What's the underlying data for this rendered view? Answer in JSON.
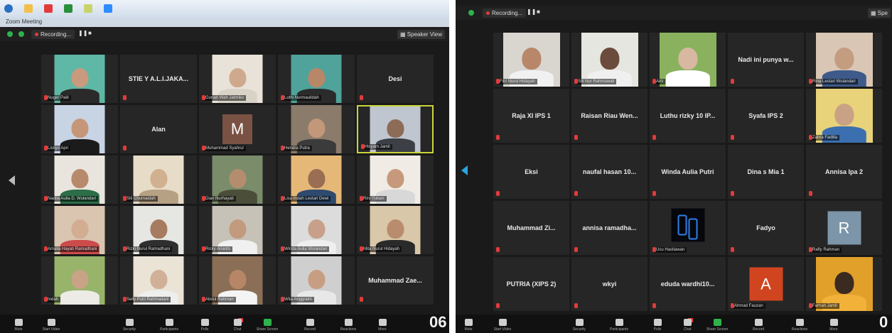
{
  "left": {
    "window_title": "Zoom Meeting",
    "recording_label": "Recording...",
    "view_label": "Speaker View",
    "clock": "06",
    "tiles": [
      {
        "type": "photo",
        "name": "",
        "label": "Nuger Paiti",
        "bg": "#5fb7a6",
        "skin": "#c99a7d",
        "cloth": "#2a2a2a"
      },
      {
        "type": "text",
        "name": "STIE Y A.L.I.JAKA...",
        "label": ""
      },
      {
        "type": "photo",
        "name": "",
        "label": "Gunari Wah Jatmiko",
        "bg": "#e8e2d8",
        "skin": "#cfa98e",
        "cloth": "#d9d2c6"
      },
      {
        "type": "photo",
        "name": "",
        "label": "Luthi Nurmaulidah",
        "bg": "#4fa39a",
        "skin": "#b88768",
        "cloth": "#2b2b2b"
      },
      {
        "type": "text",
        "name": "Desi",
        "label": ""
      },
      {
        "type": "photo",
        "name": "",
        "label": "Listiyo Apri",
        "bg": "#c8d3e4",
        "skin": "#c69678",
        "cloth": "#1b1b1b"
      },
      {
        "type": "text",
        "name": "Alan",
        "label": ""
      },
      {
        "type": "letter",
        "letter": "M",
        "letter_bg": "#7a5243",
        "label": "Muhammad Syahrul"
      },
      {
        "type": "photo",
        "name": "",
        "label": "Hendra Putra",
        "bg": "#8b7b6b",
        "skin": "#c3977a",
        "cloth": "#3b3b3b"
      },
      {
        "type": "photo",
        "name": "",
        "label": "Hisyam Jamil",
        "bg": "#bfc6cf",
        "skin": "#8c6b57",
        "cloth": "#3c3f45",
        "active": true
      },
      {
        "type": "photo",
        "name": "",
        "label": "Nadila Aulia D. Wulandari",
        "bg": "#e9e5de",
        "skin": "#b88a6c",
        "cloth": "#2b6e48"
      },
      {
        "type": "photo",
        "name": "",
        "label": "Siti Chumaidah",
        "bg": "#e6dcc8",
        "skin": "#d0b08e",
        "cloth": "#b7a184"
      },
      {
        "type": "photo",
        "name": "",
        "label": "Dian Nurhayati",
        "bg": "#7a8c6a",
        "skin": "#b48d6f",
        "cloth": "#4b4f3a"
      },
      {
        "type": "photo",
        "name": "",
        "label": "Lisa Indah Lestari Dewi",
        "bg": "#e6b878",
        "skin": "#9a6e53",
        "cloth": "#2e4a6e"
      },
      {
        "type": "photo",
        "name": "",
        "label": "Rini Yuliani",
        "bg": "#f0ebe4",
        "skin": "#c7997c",
        "cloth": "#d8d8d8"
      },
      {
        "type": "photo",
        "name": "",
        "label": "Amalia Hayati Ramadhani",
        "bg": "#d9c5b0",
        "skin": "#d2ad92",
        "cloth": "#cc4b4b"
      },
      {
        "type": "photo",
        "name": "",
        "label": "Rizki Nurul Ramadhani",
        "bg": "#e6e6e2",
        "skin": "#a77b60",
        "cloth": "#2f2f2f"
      },
      {
        "type": "photo",
        "name": "",
        "label": "Ricky Arianto",
        "bg": "#c7c2b8",
        "skin": "#c29a7e",
        "cloth": "#f0f0f0"
      },
      {
        "type": "photo",
        "name": "",
        "label": "Winda Aulia Wulandari",
        "bg": "#dcdcdc",
        "skin": "#c8a08a",
        "cloth": "#efefef"
      },
      {
        "type": "photo",
        "name": "",
        "label": "Mita Nurul Hidayah",
        "bg": "#d8c7a8",
        "skin": "#b88c6c",
        "cloth": "#2a2a2a"
      },
      {
        "type": "photo",
        "name": "",
        "label": "Indah",
        "bg": "#97b46a",
        "skin": "#c9a386",
        "cloth": "#ecebe6"
      },
      {
        "type": "photo",
        "name": "",
        "label": "Selly Putri Rahmadani",
        "bg": "#eae3d6",
        "skin": "#d1b098",
        "cloth": "#eeeeee"
      },
      {
        "type": "photo",
        "name": "",
        "label": "Abdul Rahman",
        "bg": "#8a6f56",
        "skin": "#b68667",
        "cloth": "#f4f4f4"
      },
      {
        "type": "photo",
        "name": "",
        "label": "Wita Anggraini",
        "bg": "#d0cfcf",
        "skin": "#c89e82",
        "cloth": "#e8e8e8"
      },
      {
        "type": "text",
        "name": "Muhammad Zae...",
        "label": ""
      }
    ],
    "toolbar": [
      {
        "icon": "mic-icon",
        "label": "Mute"
      },
      {
        "icon": "video-icon",
        "label": "Start Video"
      },
      {
        "icon": "security-icon",
        "label": "Security"
      },
      {
        "icon": "participants-icon",
        "label": "Participants"
      },
      {
        "icon": "polls-icon",
        "label": "Polls"
      },
      {
        "icon": "chat-icon",
        "label": "Chat"
      },
      {
        "icon": "share-screen-icon",
        "label": "Share Screen"
      },
      {
        "icon": "record-icon",
        "label": "Record"
      },
      {
        "icon": "reactions-icon",
        "label": "Reactions"
      },
      {
        "icon": "more-icon",
        "label": "More"
      }
    ]
  },
  "right": {
    "recording_label": "Recording...",
    "view_label": "Spe",
    "clock": "0",
    "tiles": [
      {
        "type": "photo",
        "name": "",
        "label": "Fitri Nurul Hidayah",
        "bg": "#d8d6cf",
        "skin": "#b8876a",
        "cloth": "#f1f1f1"
      },
      {
        "type": "photo",
        "name": "",
        "label": "Siti Nur Rahmawati",
        "bg": "#e6e6e0",
        "skin": "#6b4b3b",
        "cloth": "#f0f0f0"
      },
      {
        "type": "photo",
        "name": "",
        "label": "Aini",
        "bg": "#8ab25e",
        "skin": "#d8b8a0",
        "cloth": "#ffffff"
      },
      {
        "type": "text",
        "name": "Nadi ini punya w...",
        "label": ""
      },
      {
        "type": "photo",
        "name": "",
        "label": "Rina Lestari Wulandari",
        "bg": "#d9c6b5",
        "skin": "#c49c80",
        "cloth": "#3d5a8a"
      },
      {
        "type": "text",
        "name": "Raja XI IPS 1",
        "label": ""
      },
      {
        "type": "text",
        "name": "Raisan Riau Wen...",
        "label": ""
      },
      {
        "type": "text",
        "name": "Luthu rizky  10 IP...",
        "label": ""
      },
      {
        "type": "text",
        "name": "Syafa IPS 2",
        "label": ""
      },
      {
        "type": "photo",
        "name": "",
        "label": "Zahra Fadilla",
        "bg": "#e8d27a",
        "skin": "#c9a285",
        "cloth": "#3b6fb0"
      },
      {
        "type": "text",
        "name": "Eksi",
        "label": ""
      },
      {
        "type": "text",
        "name": "naufal hasan 10...",
        "label": ""
      },
      {
        "type": "text",
        "name": "Winda Aulia Putri",
        "label": ""
      },
      {
        "type": "text",
        "name": "Dina  s Mia 1",
        "label": ""
      },
      {
        "type": "text",
        "name": "Annisa Ipa 2",
        "label": ""
      },
      {
        "type": "text",
        "name": "Muhammad Zi...",
        "label": ""
      },
      {
        "type": "text",
        "name": "annisa  ramadha...",
        "label": ""
      },
      {
        "type": "logo",
        "label": "Ucu Hastiawan"
      },
      {
        "type": "text",
        "name": "Fadyo",
        "label": ""
      },
      {
        "type": "letter",
        "letter": "R",
        "letter_bg": "#7c95a8",
        "label": "Rafly Rahman"
      },
      {
        "type": "text",
        "name": "PUTRIA (XIPS 2)",
        "label": ""
      },
      {
        "type": "text",
        "name": "wkyi",
        "label": ""
      },
      {
        "type": "text",
        "name": "eduda  wardhi10...",
        "label": ""
      },
      {
        "type": "letter",
        "letter": "A",
        "letter_bg": "#d0451f",
        "label": "Ahmad Fauzan"
      },
      {
        "type": "photo",
        "name": "",
        "label": "Farhan Jamil",
        "bg": "#e0a02a",
        "skin": "#3b2a20",
        "cloth": "#f2b23a"
      }
    ],
    "toolbar": [
      {
        "icon": "mic-icon",
        "label": "Mute"
      },
      {
        "icon": "video-icon",
        "label": "Start Video"
      },
      {
        "icon": "security-icon",
        "label": "Security"
      },
      {
        "icon": "participants-icon",
        "label": "Participants"
      },
      {
        "icon": "polls-icon",
        "label": "Polls"
      },
      {
        "icon": "chat-icon",
        "label": "Chat"
      },
      {
        "icon": "share-screen-icon",
        "label": "Share Screen"
      },
      {
        "icon": "record-icon",
        "label": "Record"
      },
      {
        "icon": "reactions-icon",
        "label": "Reactions"
      },
      {
        "icon": "more-icon",
        "label": "More"
      }
    ]
  },
  "colors": {
    "active_speaker": "#c9d63a",
    "muted_mic": "#e23b3b",
    "record_dot": "#e23b3b",
    "nav_arrow_right": "#2aa3e0"
  }
}
